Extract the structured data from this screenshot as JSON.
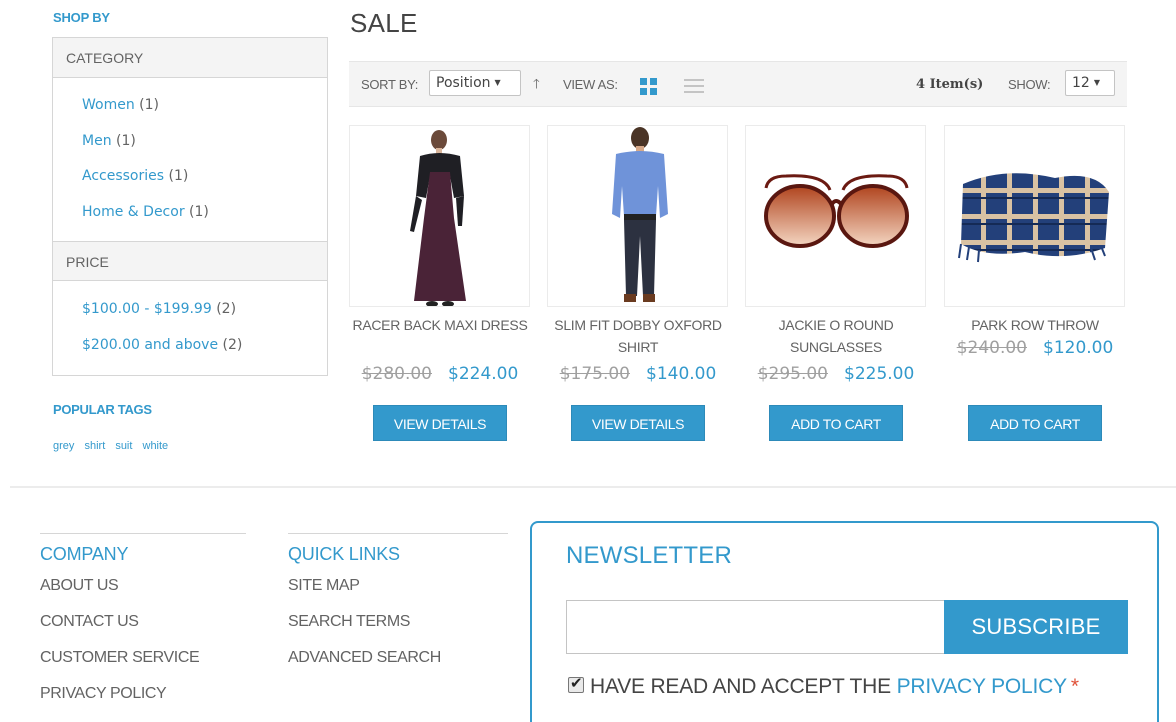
{
  "sidebar": {
    "shop_by": "SHOP BY",
    "category": {
      "title": "CATEGORY",
      "items": [
        {
          "label": "Women",
          "count": "(1)"
        },
        {
          "label": "Men",
          "count": "(1)"
        },
        {
          "label": "Accessories",
          "count": "(1)"
        },
        {
          "label": "Home & Decor",
          "count": "(1)"
        }
      ]
    },
    "price": {
      "title": "PRICE",
      "items": [
        {
          "label": "$100.00 - $199.99",
          "count": "(2)"
        },
        {
          "label": "$200.00 and above",
          "count": "(2)"
        }
      ]
    },
    "popular_tags": {
      "title": "POPULAR TAGS",
      "tags": [
        "grey",
        "shirt",
        "suit",
        "white"
      ]
    }
  },
  "main": {
    "title": "SALE",
    "toolbar": {
      "sort_label": "SORT BY:",
      "sort_value": "Position",
      "view_label": "VIEW AS:",
      "items_count": "4 Item(s)",
      "show_label": "SHOW:",
      "show_value": "12"
    },
    "products": [
      {
        "name": "RACER BACK MAXI DRESS",
        "old_price": "$280.00",
        "new_price": "$224.00",
        "button": "VIEW DETAILS"
      },
      {
        "name": "SLIM FIT DOBBY OXFORD SHIRT",
        "old_price": "$175.00",
        "new_price": "$140.00",
        "button": "VIEW DETAILS"
      },
      {
        "name": "JACKIE O ROUND SUNGLASSES",
        "old_price": "$295.00",
        "new_price": "$225.00",
        "button": "ADD TO CART"
      },
      {
        "name": "PARK ROW THROW",
        "old_price": "$240.00",
        "new_price": "$120.00",
        "button": "ADD TO CART"
      }
    ]
  },
  "footer": {
    "company": {
      "title": "COMPANY",
      "links": [
        "ABOUT US",
        "CONTACT US",
        "CUSTOMER SERVICE",
        "PRIVACY POLICY"
      ]
    },
    "quick_links": {
      "title": "QUICK LINKS",
      "links": [
        "SITE MAP",
        "SEARCH TERMS",
        "ADVANCED SEARCH"
      ]
    },
    "newsletter": {
      "title": "NEWSLETTER",
      "email_value": "",
      "subscribe_label": "SUBSCRIBE",
      "accept_text": "HAVE READ AND ACCEPT THE",
      "privacy_link": "PRIVACY POLICY",
      "required_mark": "*"
    }
  },
  "colors": {
    "accent": "#3399cc",
    "required": "#e0533a"
  },
  "icons": {
    "sort_direction": "arrow-up-icon",
    "view_grid": "grid-icon",
    "view_list": "list-icon",
    "checkbox": "checkmark-icon"
  }
}
